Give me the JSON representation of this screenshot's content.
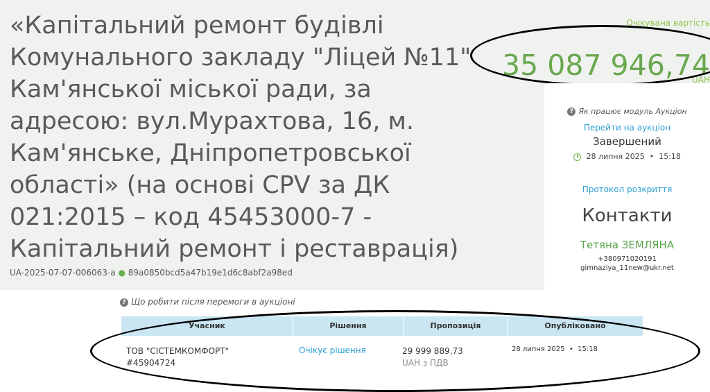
{
  "tender": {
    "title": "«Капітальний ремонт будівлі Комунального закладу \"Ліцей №11\" Кам'янської міської ради, за адресою: вул.Мурахтова, 16, м. Кам'янське, Дніпропетровської області» (на основі CPV за ДК 021:2015 – код 45453000-7 - Капітальний ремонт і реставрація)",
    "id": "UA-2025-07-07-006063-a",
    "hash": "89a0850bcd5a47b19e1d6c8abf2a98ed"
  },
  "value": {
    "label": "Очікувана вартість",
    "amount": "35 087 946,74",
    "currency": "UAH"
  },
  "side": {
    "help": "Як працює модуль Аукціон",
    "auction_link": "Перейти на аукціон",
    "status": "Завершений",
    "date": "28 липня 2025",
    "time": "15:18",
    "protocol_link": "Протокол розкриття",
    "contacts_title": "Контакти",
    "contact_name": "Тетяна ЗЕМЛЯНА",
    "contact_phone": "+380971020191",
    "contact_email": "gimnaziya_11new@ukr.net"
  },
  "bids": {
    "help": "Що робити після перемоги в аукціоні",
    "headers": [
      "Учасник",
      "Рішення",
      "Пропозиція",
      "Опубліковано"
    ],
    "rows": [
      {
        "participant": "ТОВ \"СІСТЕМКОМФОРТ\"",
        "participant_id": "#45904724",
        "decision": "Очікує рішення",
        "amount": "29 999 889,73",
        "amount_note": "UAH з ПДВ",
        "date": "28 липня 2025",
        "time": "15:18"
      }
    ]
  },
  "colors": {
    "accent_green": "#6aa84f",
    "link_blue": "#2b9fd4",
    "header_blue": "#c9e6f2"
  }
}
